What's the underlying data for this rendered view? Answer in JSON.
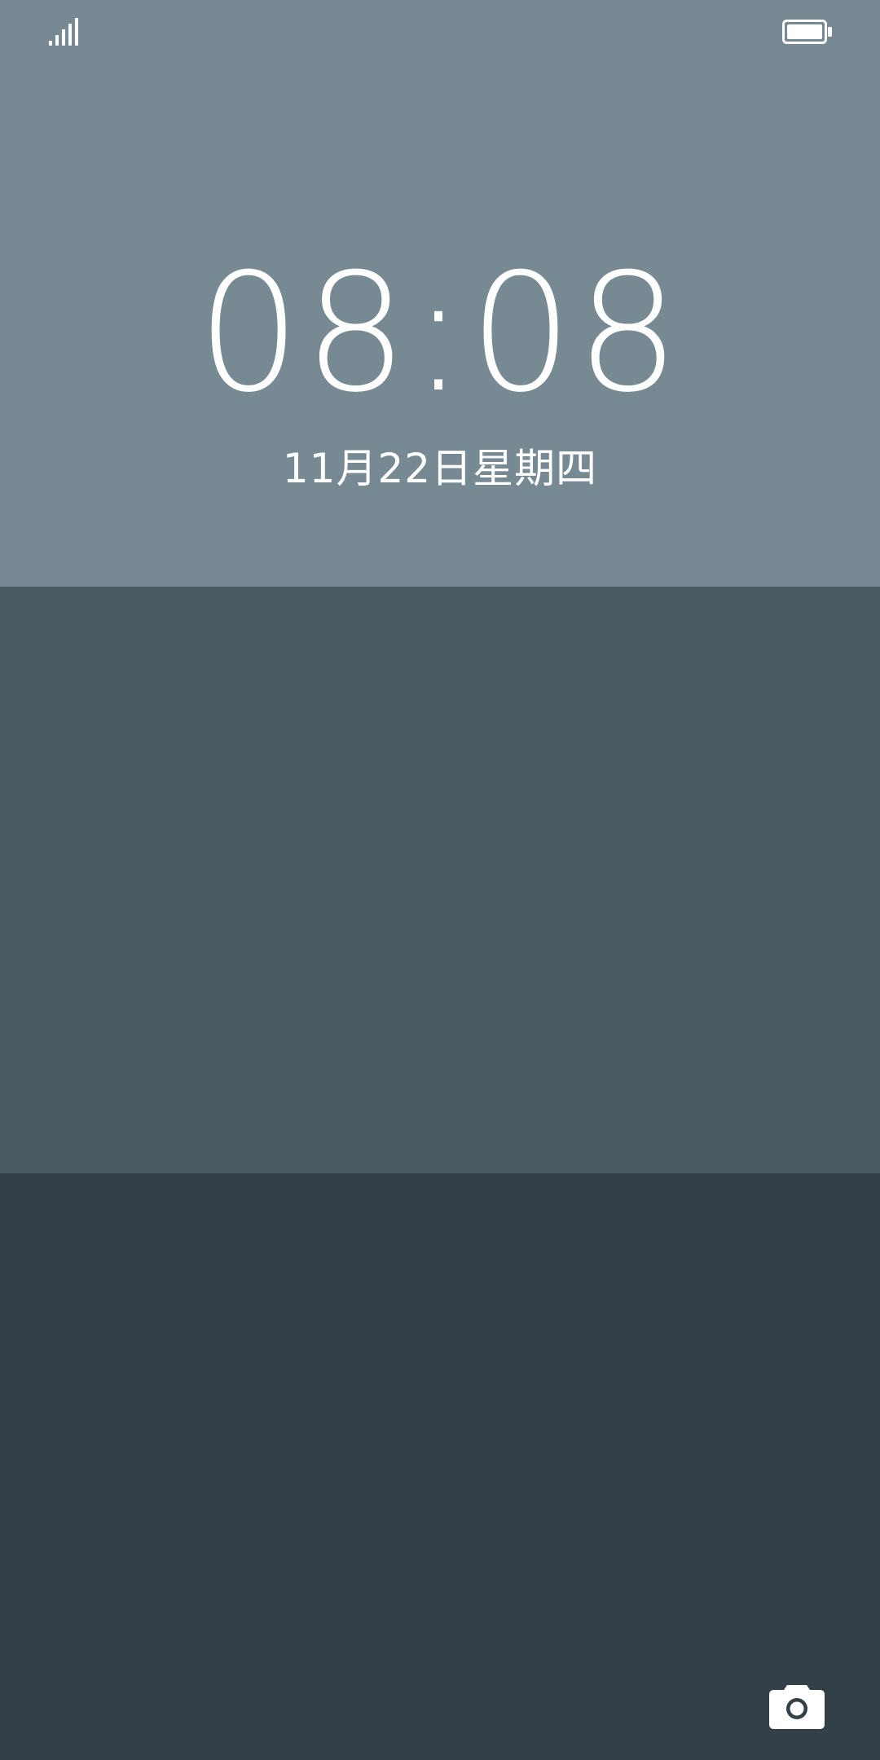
{
  "status_bar": {
    "signal_icon": "signal-strength-icon",
    "battery_icon": "battery-full-icon"
  },
  "lock_screen": {
    "time": "08:08",
    "date": "11月22日星期四"
  },
  "shortcuts": {
    "camera_icon": "camera-icon"
  },
  "colors": {
    "band_top": "#778992",
    "band_middle": "#4b5a62",
    "band_bottom": "#344047",
    "text": "#ffffff"
  }
}
